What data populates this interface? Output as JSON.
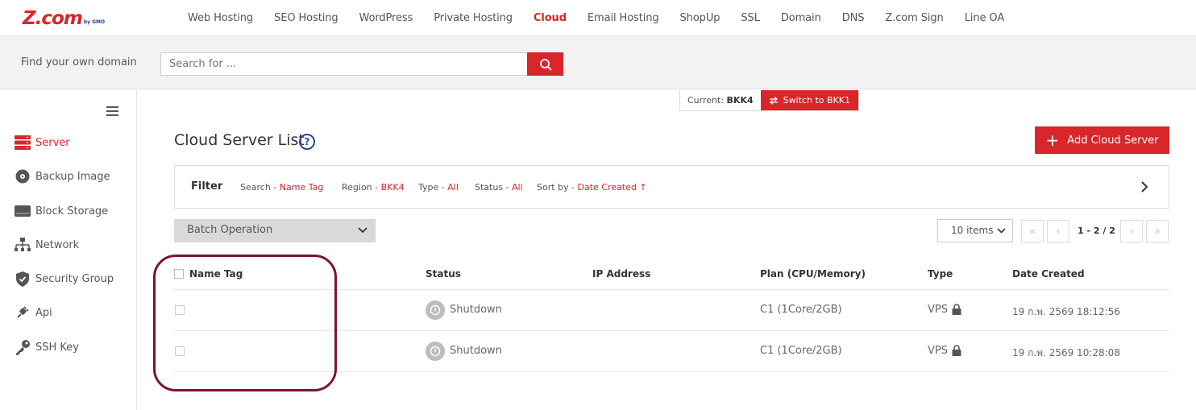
{
  "logo": {
    "text": "Z.com",
    "by": "by GMO"
  },
  "nav": [
    "Web Hosting",
    "SEO Hosting",
    "WordPress",
    "Private Hosting",
    "Cloud",
    "Email Hosting",
    "ShopUp",
    "SSL",
    "Domain",
    "DNS",
    "Z.com Sign",
    "Line OA"
  ],
  "nav_active": "Cloud",
  "domain": {
    "label": "Find your own domain",
    "placeholder": "Search for ..."
  },
  "sidebar": [
    {
      "label": "Server",
      "icon": "server-icon"
    },
    {
      "label": "Backup Image",
      "icon": "disc-icon"
    },
    {
      "label": "Block Storage",
      "icon": "drive-icon"
    },
    {
      "label": "Network",
      "icon": "network-icon"
    },
    {
      "label": "Security Group",
      "icon": "shield-icon"
    },
    {
      "label": "Api",
      "icon": "plug-icon"
    },
    {
      "label": "SSH Key",
      "icon": "key-icon"
    }
  ],
  "region": {
    "current_label": "Current:",
    "current_value": "BKK4",
    "switch_label": "Switch to BKK1"
  },
  "page": {
    "title": "Cloud Server List",
    "add_label": "Add Cloud Server"
  },
  "filter": {
    "title": "Filter",
    "items": [
      {
        "label": "Search - ",
        "value": "Name Tag"
      },
      {
        "label": "Region - ",
        "value": "BKK4"
      },
      {
        "label": "Type - ",
        "value": "All"
      },
      {
        "label": "Status - ",
        "value": "All"
      },
      {
        "label": "Sort by - ",
        "value": "Date Created ↑"
      }
    ]
  },
  "batch_label": "Batch Operation",
  "pagination": {
    "items_label": "10 items",
    "range": "1 - 2 / 2"
  },
  "table": {
    "headers": [
      "Name Tag",
      "Status",
      "IP Address",
      "Plan (CPU/Memory)",
      "Type",
      "Date Created"
    ],
    "rows": [
      {
        "name": "",
        "status": "Shutdown",
        "ip": "",
        "plan": "C1 (1Core/2GB)",
        "type": "VPS",
        "date": "19 ก.พ. 2569 18:12:56"
      },
      {
        "name": "",
        "status": "Shutdown",
        "ip": "",
        "plan": "C1 (1Core/2GB)",
        "type": "VPS",
        "date": "19 ก.พ. 2569 10:28:08"
      }
    ]
  },
  "colors": {
    "brand": "#d8262b",
    "annotation": "#7a1728"
  }
}
